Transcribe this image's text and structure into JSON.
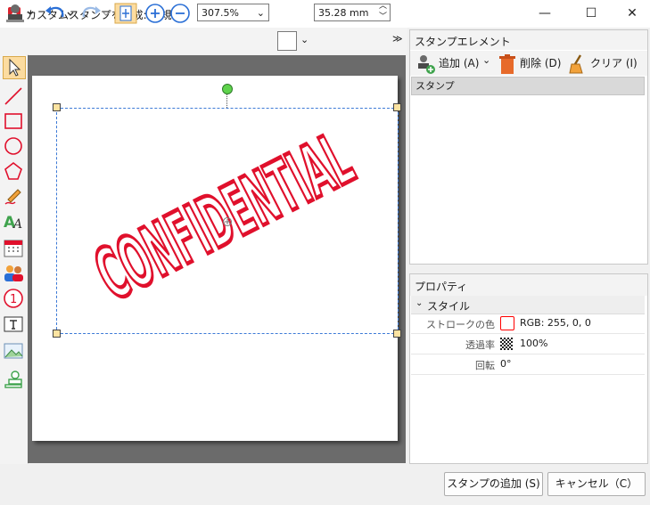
{
  "window": {
    "title": "カスタムスタンプを生成: 新規*",
    "controls": {
      "minimize": "—",
      "maximize": "☐",
      "close": "✕"
    }
  },
  "toolbar": {
    "zoom": "307.5%",
    "size": "35.28 mm"
  },
  "canvas": {
    "stamp_text": "CONFIDENTIAL",
    "stamp_color": "#e0102c"
  },
  "stamp_elements": {
    "header": "スタンプエレメント",
    "add_label": "追加 (A)",
    "delete_label": "削除 (D)",
    "clear_label": "クリア (I)",
    "list": [
      "スタンプ"
    ]
  },
  "properties": {
    "header": "プロパティ",
    "section": "スタイル",
    "rows": [
      {
        "label": "ストロークの色",
        "value": "RGB: 255, 0, 0",
        "swatch": "#ff0000"
      },
      {
        "label": "透過率",
        "value": "100%"
      },
      {
        "label": "回転",
        "value": "0°"
      }
    ]
  },
  "footer": {
    "add_stamp": "スタンプの追加 (S)",
    "cancel": "キャンセル（C）"
  }
}
